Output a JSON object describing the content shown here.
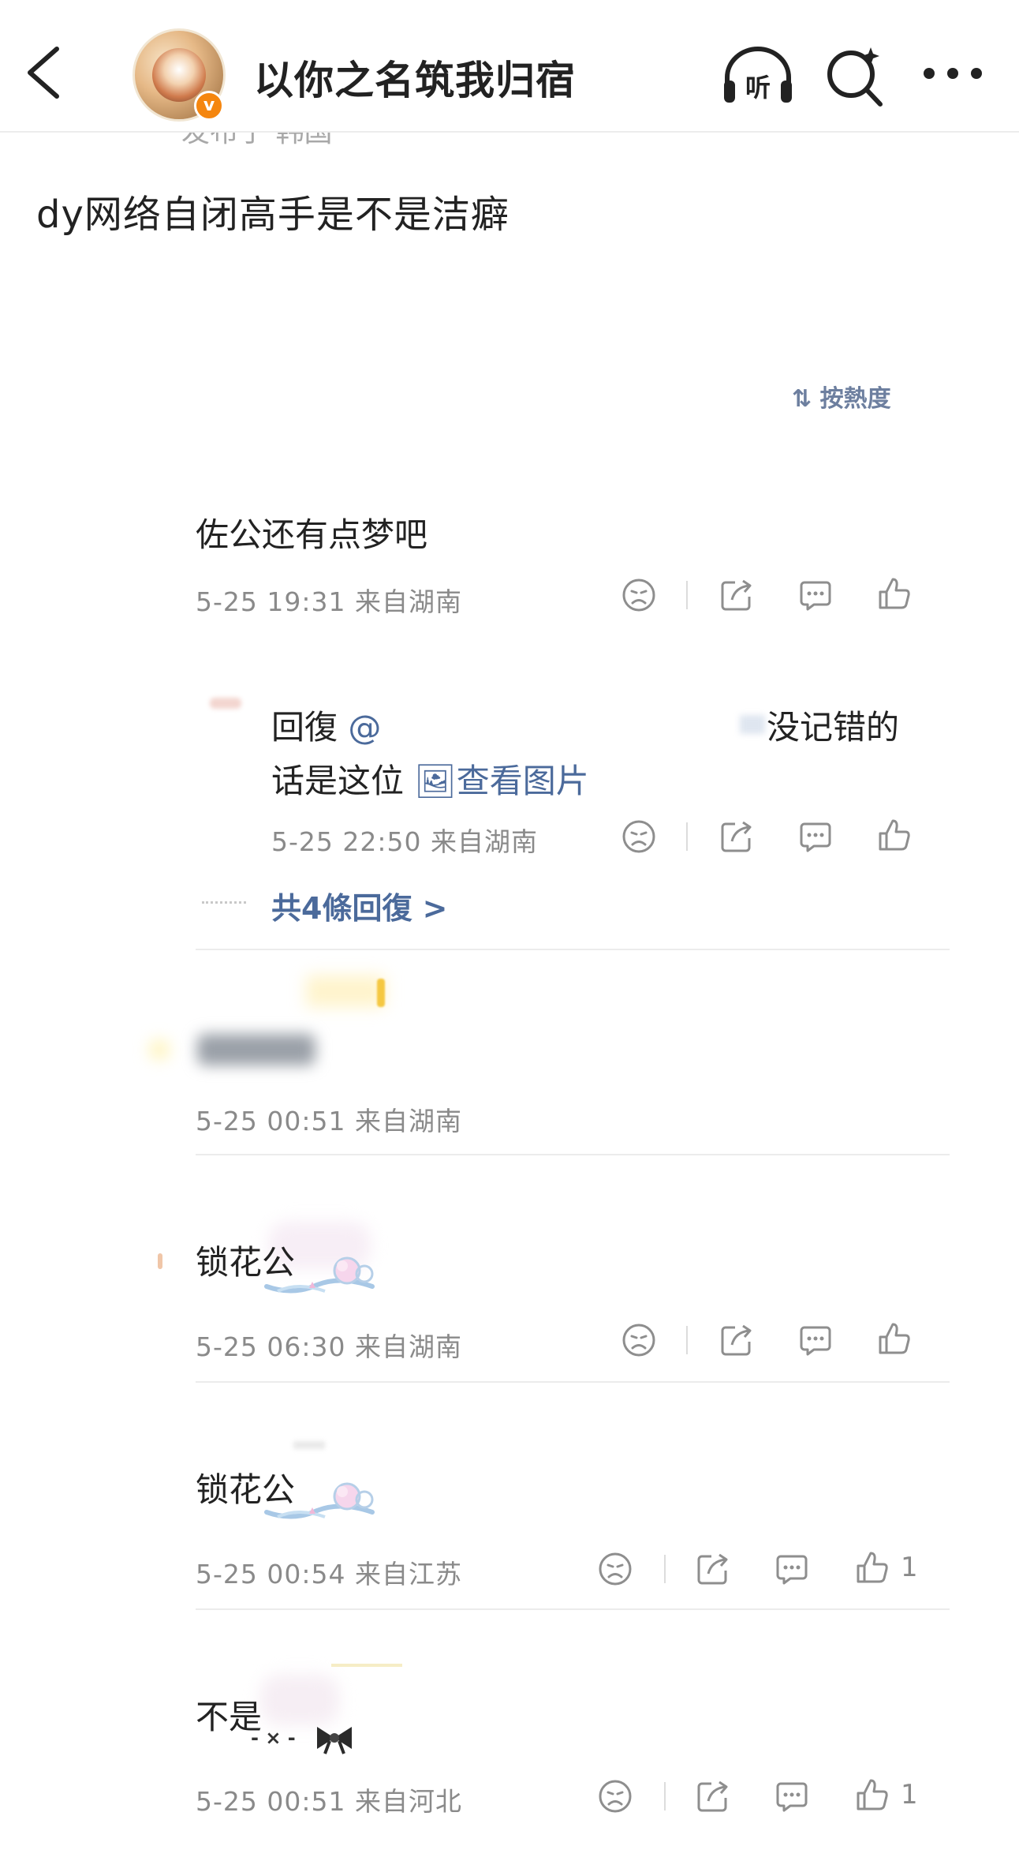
{
  "header": {
    "account_name": "以你之名筑我归宿",
    "faded_meta": "发布于 韩国",
    "icons": [
      "back-icon",
      "avatar",
      "verified-badge",
      "listen-icon",
      "search-icon",
      "more-icon"
    ],
    "listen_glyph": "听",
    "verified_glyph": "v"
  },
  "post": {
    "text": "dy网络自闭高手是不是洁癖"
  },
  "sort": {
    "label": "按熱度"
  },
  "comments": [
    {
      "text": "佐公还有点梦吧",
      "meta": "5-25 19:31 来自湖南",
      "reply": {
        "prefix": "回復 ",
        "suffix": "没记错的",
        "line2": "话是这位 ",
        "view_image": "查看图片",
        "meta": "5-25 22:50 来自湖南"
      },
      "more_replies": "共4條回復 >"
    },
    {
      "text": "",
      "meta": "5-25 00:51 来自湖南"
    },
    {
      "text": "锁花公",
      "meta": "5-25 06:30 来自湖南"
    },
    {
      "text": "锁花公",
      "meta": "5-25 00:54 来自江苏",
      "likes": "1"
    },
    {
      "text": "不是",
      "meta": "5-25 00:51 来自河北",
      "likes": "1"
    }
  ],
  "colors": {
    "link": "#4b6a9b",
    "meta": "#8a8a8a",
    "icon": "#8e8e8e",
    "verified": "#f5860f"
  }
}
